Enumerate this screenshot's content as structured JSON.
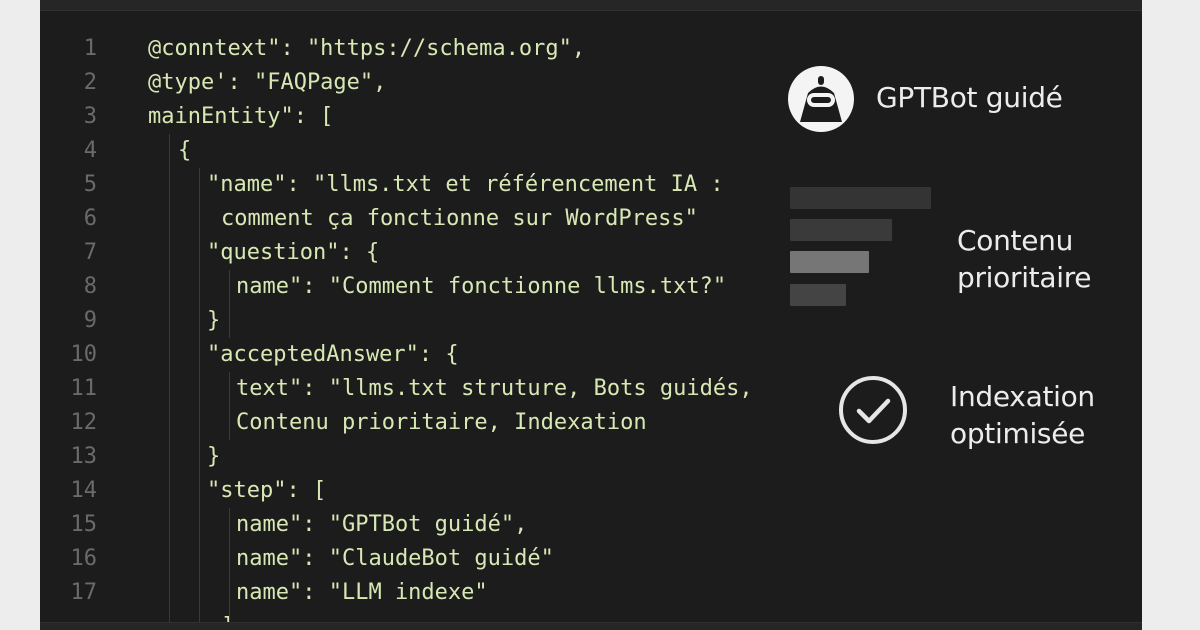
{
  "code_lines": [
    {
      "num": "1",
      "indent": 0,
      "text": "@conntext\": \"https://schema.org\","
    },
    {
      "num": "2",
      "indent": 0,
      "text": "@type': \"FAQPage\","
    },
    {
      "num": "3",
      "indent": 0,
      "text": "mainEntity\": ["
    },
    {
      "num": "4",
      "indent": 1,
      "text": "{"
    },
    {
      "num": "5",
      "indent": 2,
      "text": "\"name\": \"llms.txt et référencement IA :"
    },
    {
      "num": "6",
      "indent": 3,
      "text": "comment ça fonctionne sur WordPress\""
    },
    {
      "num": "7",
      "indent": 2,
      "text": "\"question\": {"
    },
    {
      "num": "8",
      "indent": 4,
      "text": "name\": \"Comment fonctionne llms.txt?\""
    },
    {
      "num": "9",
      "indent": 2,
      "text": "}"
    },
    {
      "num": "10",
      "indent": 2,
      "text": "\"acceptedAnswer\": {"
    },
    {
      "num": "11",
      "indent": 4,
      "text": "text\": \"llms.txt struture, Bots guidés,"
    },
    {
      "num": "12",
      "indent": 4,
      "text": "Contenu prioritaire, Indexation"
    },
    {
      "num": "13",
      "indent": 2,
      "text": "}"
    },
    {
      "num": "14",
      "indent": 2,
      "text": "\"step\": ["
    },
    {
      "num": "15",
      "indent": 4,
      "text": "name\": \"GPTBot guidé\","
    },
    {
      "num": "16",
      "indent": 4,
      "text": "name\": \"ClaudeBot guidé\""
    },
    {
      "num": "17",
      "indent": 4,
      "text": "name\": \"LLM indexe\""
    },
    {
      "num": "",
      "indent": 3,
      "text": "]"
    }
  ],
  "panel": {
    "bot": {
      "icon": "robot-icon",
      "label": "GPTBot guidé"
    },
    "priority": {
      "icon": "bars-icon",
      "label_line1": "Contenu",
      "label_line2": "prioritaire"
    },
    "indexation": {
      "icon": "check-circle-icon",
      "label_line1": "Indexation",
      "label_line2": "optimisée"
    }
  },
  "colors": {
    "background": "#1c1c1c",
    "code_text": "#d8e8b4",
    "line_numbers": "#6a6a6a",
    "panel_text": "#ececec"
  }
}
